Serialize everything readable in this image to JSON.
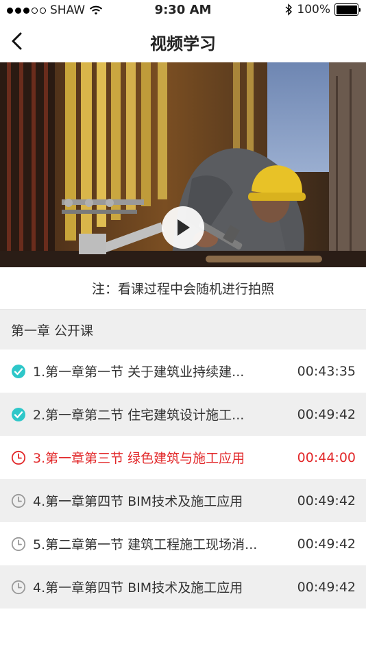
{
  "status_bar": {
    "carrier": "SHAW",
    "time": "9:30 AM",
    "battery": "100%",
    "signal_bars_filled": 3,
    "signal_bars_total": 5
  },
  "nav": {
    "title": "视频学习",
    "back_icon": "chevron-left-icon"
  },
  "video": {
    "play_icon": "play-icon"
  },
  "notice": "注：看课过程中会随机进行拍照",
  "chapter": {
    "title": "第一章 公开课"
  },
  "lessons": [
    {
      "title": "1.第一章第一节 关于建筑业持续建...",
      "duration": "00:43:35",
      "status": "completed",
      "icon": "check-circle-icon"
    },
    {
      "title": "2.第一章第二节 住宅建筑设计施工...",
      "duration": "00:49:42",
      "status": "completed",
      "icon": "check-circle-icon"
    },
    {
      "title": "3.第一章第三节 绿色建筑与施工应用",
      "duration": "00:44:00",
      "status": "playing",
      "icon": "clock-icon"
    },
    {
      "title": "4.第一章第四节 BIM技术及施工应用",
      "duration": "00:49:42",
      "status": "pending",
      "icon": "clock-icon"
    },
    {
      "title": "5.第二章第一节 建筑工程施工现场消...",
      "duration": "00:49:42",
      "status": "pending",
      "icon": "clock-icon"
    },
    {
      "title": "4.第一章第四节 BIM技术及施工应用",
      "duration": "00:49:42",
      "status": "pending",
      "icon": "clock-icon"
    }
  ],
  "colors": {
    "completed": "#2ec7c9",
    "active": "#e2282a",
    "pending": "#9a9a9a"
  }
}
